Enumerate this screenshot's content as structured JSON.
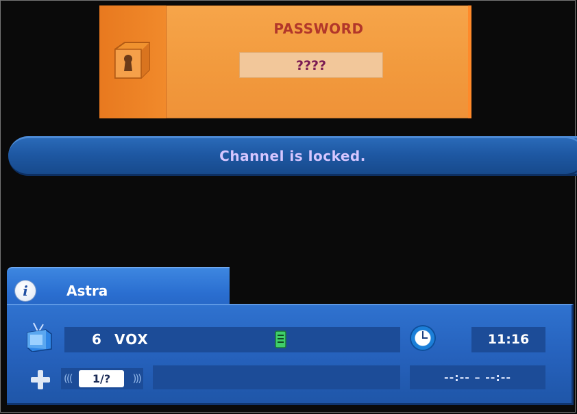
{
  "password_dialog": {
    "title": "PASSWORD",
    "input_value": "????"
  },
  "status": {
    "message": "Channel is locked."
  },
  "info_banner": {
    "info_icon_glyph": "i",
    "satellite": "Astra",
    "channel_number": "6",
    "channel_name": "VOX",
    "time": "11:16",
    "subtitle_track": "1/?",
    "program_time": "--:-- – --:--"
  },
  "icons": {
    "lock": "lock-icon",
    "info": "info-icon",
    "tv": "tv-icon",
    "list": "list-icon",
    "clock": "clock-icon",
    "plus": "plus-icon"
  },
  "colors": {
    "dialog_orange": "#f29a3d",
    "title_red": "#b2372a",
    "bar_blue": "#1e58a3",
    "message_text": "#d6c6ff",
    "panel_blue": "#2662bd"
  }
}
